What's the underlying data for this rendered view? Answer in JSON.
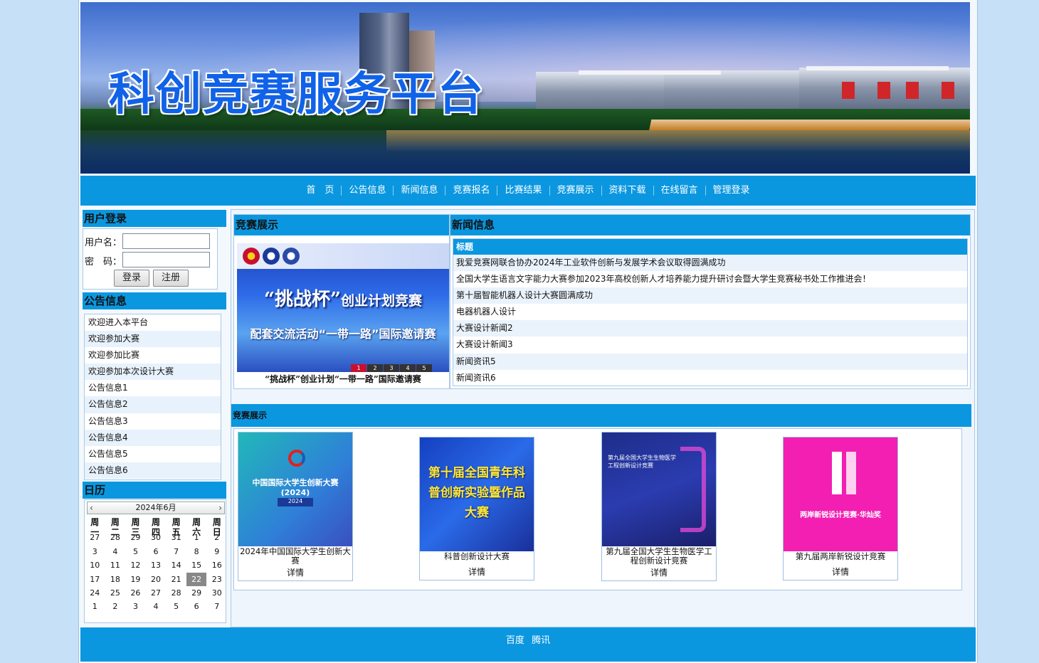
{
  "banner": {
    "title": "科创竞赛服务平台"
  },
  "nav": [
    "首　页",
    "公告信息",
    "新闻信息",
    "竞赛报名",
    "比赛结果",
    "竞赛展示",
    "资料下载",
    "在线留言",
    "管理登录"
  ],
  "login": {
    "heading": "用户登录",
    "username_label": "用户名：",
    "password_label": "密　码：",
    "login_button": "登录",
    "register_button": "注册"
  },
  "notices": {
    "heading": "公告信息",
    "items": [
      "欢迎进入本平台",
      "欢迎参加大赛",
      "欢迎参加比赛",
      "欢迎参加本次设计大赛",
      "公告信息1",
      "公告信息2",
      "公告信息3",
      "公告信息4",
      "公告信息5",
      "公告信息6"
    ]
  },
  "calendar": {
    "heading": "日历",
    "month": "2024年6月",
    "weekdays": [
      "周一",
      "周二",
      "周三",
      "周四",
      "周五",
      "周六",
      "周日"
    ],
    "weeks": [
      [
        "27",
        "28",
        "29",
        "30",
        "31",
        "1",
        "2"
      ],
      [
        "3",
        "4",
        "5",
        "6",
        "7",
        "8",
        "9"
      ],
      [
        "10",
        "11",
        "12",
        "13",
        "14",
        "15",
        "16"
      ],
      [
        "17",
        "18",
        "19",
        "20",
        "21",
        "22",
        "23"
      ],
      [
        "24",
        "25",
        "26",
        "27",
        "28",
        "29",
        "30"
      ],
      [
        "1",
        "2",
        "3",
        "4",
        "5",
        "6",
        "7"
      ]
    ],
    "today": "22"
  },
  "showcase_panel": {
    "heading": "竞赛展示",
    "slide_title_main": "“挑战杯”",
    "slide_title_sub": "创业计划竞赛",
    "slide_line2": "配套交流活动“一带一路”国际邀请赛",
    "slide_numbers": [
      "1",
      "2",
      "3",
      "4",
      "5"
    ],
    "slide_caption": "“挑战杯”创业计划“一带一路”国际邀请赛"
  },
  "news": {
    "heading": "新闻信息",
    "column_title": "标题",
    "items": [
      "我爱竞赛网联合协办2024年工业软件创新与发展学术会议取得圆满成功",
      "全国大学生语言文字能力大赛参加2023年高校创新人才培养能力提升研讨会暨大学生竞赛秘书处工作推进会！",
      "第十届智能机器人设计大赛圆满成功",
      "电器机器人设计",
      "大赛设计新闻2",
      "大赛设计新闻3",
      "新闻资讯5",
      "新闻资讯6"
    ]
  },
  "showcase": {
    "heading": "竞赛展示",
    "detail_label": "详情",
    "cards": [
      {
        "caption": "2024年中国国际大学生创新大赛",
        "image_text": "中国国际大学生创新大赛(2024)",
        "color": "#2fb6d8"
      },
      {
        "caption": "科普创新设计大赛",
        "image_text": "第十届全国青年科普创新实验暨作品大赛",
        "color": "#1b3fb0"
      },
      {
        "caption": "第九届全国大学生生物医学工程创新设计竞赛",
        "image_text": "第九届全国大学生生物医学工程创新设计竞赛",
        "color": "#2a3aa8"
      },
      {
        "caption": "第九届两岸新锐设计竞赛",
        "image_text": "两岸新锐设计竞赛·华灿奖",
        "color": "#f21fb2"
      }
    ]
  },
  "footer": {
    "links": [
      "百度",
      "腾讯"
    ]
  }
}
